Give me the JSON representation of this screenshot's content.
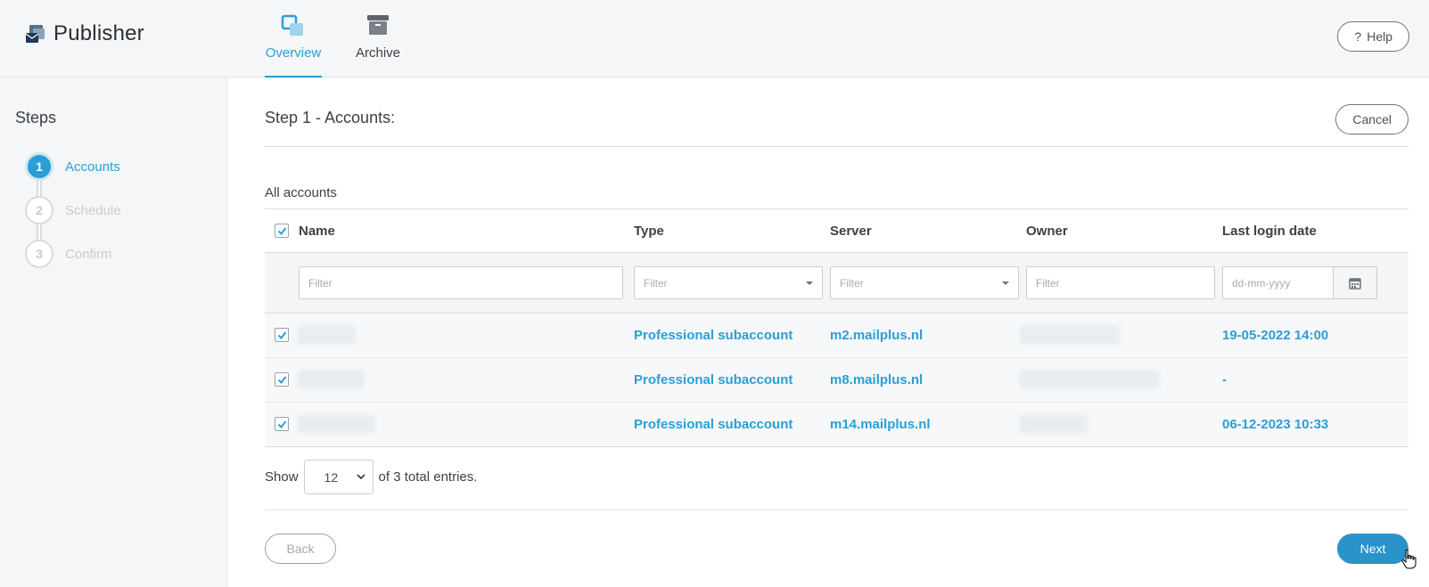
{
  "app": {
    "title": "Publisher"
  },
  "tabs": [
    {
      "label": "Overview",
      "active": true,
      "icon": "overview-icon"
    },
    {
      "label": "Archive",
      "active": false,
      "icon": "archive-icon"
    }
  ],
  "header": {
    "help_label": "Help",
    "help_icon": "question-icon"
  },
  "sidebar": {
    "title": "Steps",
    "steps": [
      {
        "number": "1",
        "label": "Accounts",
        "active": true
      },
      {
        "number": "2",
        "label": "Schedule",
        "active": false
      },
      {
        "number": "3",
        "label": "Confirm",
        "active": false
      }
    ]
  },
  "main": {
    "step_title": "Step 1 - Accounts:",
    "cancel_label": "Cancel",
    "section_title": "All accounts",
    "columns": [
      "Name",
      "Type",
      "Server",
      "Owner",
      "Last login date"
    ],
    "filters": {
      "name_placeholder": "Filter",
      "type_placeholder": "Filter",
      "server_placeholder": "Filter",
      "owner_placeholder": "Filter",
      "date_placeholder": "dd-mm-yyyy"
    },
    "rows": [
      {
        "type": "Professional subaccount",
        "server": "m2.mailplus.nl",
        "last_login": "19-05-2022 14:00"
      },
      {
        "type": "Professional subaccount",
        "server": "m8.mailplus.nl",
        "last_login": "-"
      },
      {
        "type": "Professional subaccount",
        "server": "m14.mailplus.nl",
        "last_login": "06-12-2023 10:33"
      }
    ],
    "pager": {
      "show_label": "Show",
      "page_size": "12",
      "total_text": "of 3 total entries."
    },
    "back_label": "Back",
    "next_label": "Next"
  },
  "colors": {
    "accent": "#2a9fd6",
    "primary_button": "#2a93c9"
  }
}
